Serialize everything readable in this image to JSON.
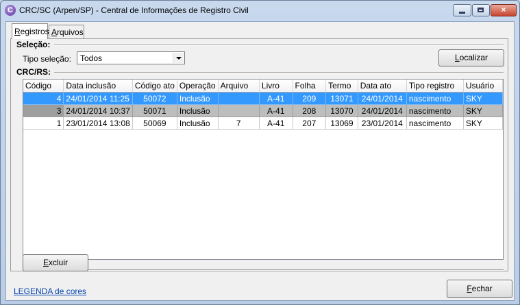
{
  "window": {
    "title": "CRC/SC (Arpen/SP) - Central de Informações de Registro Civil",
    "icon": "crc-app-icon",
    "close_glyph": "×"
  },
  "tabs": [
    {
      "label": "Registros",
      "accel": "R",
      "rest": "egistros",
      "active": true
    },
    {
      "label": "Arquivos",
      "accel": "A",
      "rest": "rquivos",
      "active": false
    }
  ],
  "selecao": {
    "group_label": "Seleção:",
    "tipo_label": "Tipo seleção:",
    "tipo_value": "Todos",
    "localizar_accel": "L",
    "localizar_rest": "ocalizar"
  },
  "crcrs": {
    "group_label": "CRC/RS:",
    "columns": [
      "Código",
      "Data inclusão",
      "Código ato",
      "Operação",
      "Arquivo",
      "Livro",
      "Folha",
      "Termo",
      "Data ato",
      "Tipo registro",
      "Usuário"
    ],
    "rows": [
      {
        "style": "selected",
        "cells": [
          "4",
          "24/01/2014 11:25",
          "50072",
          "Inclusão",
          "",
          "A-41",
          "209",
          "13071",
          "24/01/2014",
          "nascimento",
          "SKY"
        ]
      },
      {
        "style": "gray",
        "cells": [
          "3",
          "24/01/2014 10:37",
          "50071",
          "Inclusão",
          "",
          "A-41",
          "208",
          "13070",
          "24/01/2014",
          "nascimento",
          "SKY"
        ]
      },
      {
        "style": "white",
        "cells": [
          "1",
          "23/01/2014 13:08",
          "50069",
          "Inclusão",
          "7",
          "A-41",
          "207",
          "13069",
          "23/01/2014",
          "nascimento",
          "SKY"
        ]
      }
    ]
  },
  "excluir": {
    "accel": "E",
    "rest": "xcluir"
  },
  "legenda_link": "LEGENDA de cores",
  "fechar": {
    "accel": "F",
    "rest": "echar"
  },
  "colors": {
    "selected_row": "#3399ff",
    "gray_row": "#bdbdbd",
    "link": "#0645ad"
  }
}
